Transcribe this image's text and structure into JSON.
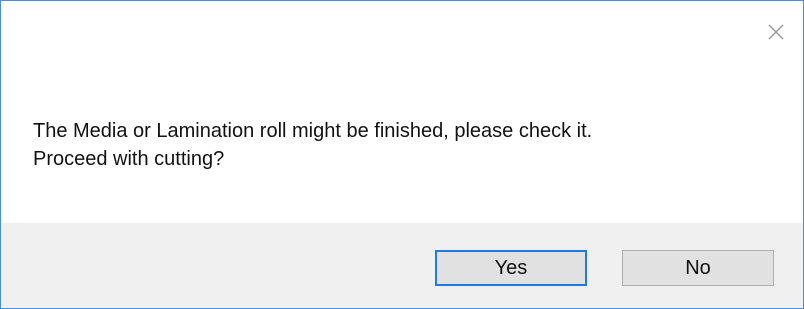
{
  "dialog": {
    "message_lines": [
      "The Media or Lamination roll might be finished, please check it.",
      "Proceed with cutting?"
    ],
    "buttons": {
      "yes_label": "Yes",
      "no_label": "No"
    },
    "close_icon": "close-icon",
    "colors": {
      "border": "#4a8fd6",
      "button_bar_bg": "#f0f0f0",
      "button_bg": "#e1e1e1",
      "default_button_border": "#1e7be0"
    }
  }
}
